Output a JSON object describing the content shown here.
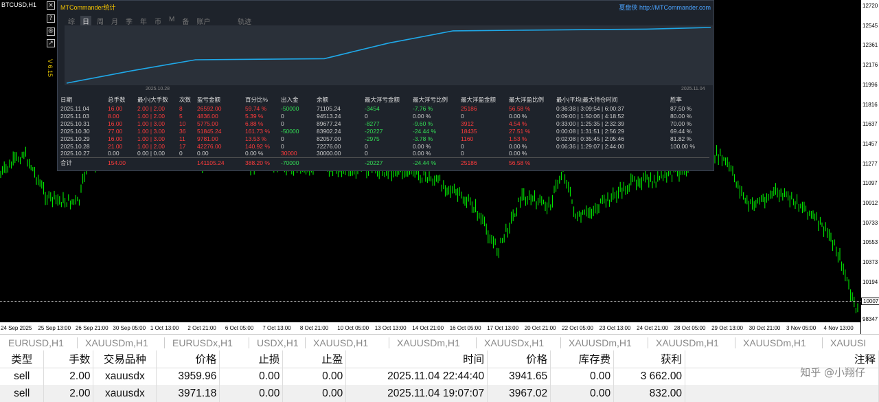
{
  "chart": {
    "symbol_label": "BTCUSD,H1",
    "vertical_label": "V 6.15",
    "side_buttons": [
      "×",
      "?",
      "®"
    ],
    "price_ticks": [
      "12720",
      "12545",
      "12361",
      "12176",
      "11996",
      "11816",
      "11637",
      "11457",
      "11277",
      "11097",
      "10912",
      "10733",
      "10553",
      "10373",
      "10194"
    ],
    "current_price": "10007",
    "bottom_price": "98347",
    "time_ticks": [
      "24 Sep 2025",
      "25 Sep 13:00",
      "26 Sep 21:00",
      "30 Sep 05:00",
      "1 Oct 13:00",
      "2 Oct 21:00",
      "6 Oct 05:00",
      "7 Oct 13:00",
      "8 Oct 21:00",
      "10 Oct 05:00",
      "13 Oct 13:00",
      "14 Oct 21:00",
      "16 Oct 05:00",
      "17 Oct 13:00",
      "20 Oct 21:00",
      "22 Oct 05:00",
      "23 Oct 13:00",
      "24 Oct 21:00",
      "28 Oct 05:00",
      "29 Oct 13:00",
      "30 Oct 21:00",
      "3 Nov 05:00",
      "4 Nov 13:00"
    ],
    "candle_color": "#00ff00"
  },
  "mtc": {
    "title": "MTCommander统计",
    "brand_cn": "夏盘侠",
    "brand_url": "http://MTCommander.com",
    "tabs": [
      "综",
      "日",
      "周",
      "月",
      "季",
      "年",
      "币",
      "M",
      "备",
      "账户"
    ],
    "active_tab": "日",
    "trade_tab": "轨迹",
    "eq_start_date": "2025.10.28",
    "eq_end_date": "2025.11.04",
    "equity_curve": [
      0,
      0.22,
      0.42,
      0.43,
      0.44,
      0.72,
      0.94,
      0.95,
      0.96,
      0.97,
      1.0
    ],
    "equity_line_color": "#1fa8e8",
    "headers": [
      "日期",
      "总手数",
      "最小|大手数",
      "次数",
      "盈亏金额",
      "百分比%",
      "出入金",
      "余额",
      "最大浮亏金额",
      "最大浮亏比例",
      "最大浮盈金额",
      "最大浮盈比例",
      "最小|平均|最大持仓时间",
      "胜率"
    ],
    "rows": [
      [
        "2025.11.04",
        "16.00",
        "2.00 | 2.00",
        "8",
        "26592.00",
        "59.74 %",
        "-50000",
        "71105.24",
        "-3454",
        "-7.76 %",
        "25186",
        "56.58 %",
        "0:36:38 | 3:09:54 | 6:00:37",
        "87.50 %"
      ],
      [
        "2025.11.03",
        "8.00",
        "1.00 | 2.00",
        "5",
        "4836.00",
        "5.39 %",
        "0",
        "94513.24",
        "0",
        "0.00 %",
        "0",
        "0.00 %",
        "0:09:00 | 1:50:06 | 4:18:52",
        "80.00 %"
      ],
      [
        "2025.10.31",
        "16.00",
        "1.00 | 3.00",
        "10",
        "5775.00",
        "6.88 %",
        "0",
        "89677.24",
        "-8277",
        "-9.60 %",
        "3912",
        "4.54 %",
        "0:33:00 | 1:25:35 | 2:32:39",
        "70.00 %"
      ],
      [
        "2025.10.30",
        "77.00",
        "1.00 | 3.00",
        "36",
        "51845.24",
        "161.73 %",
        "-50000",
        "83902.24",
        "-20227",
        "-24.44 %",
        "18435",
        "27.51 %",
        "0:00:08 | 1:31:51 | 2:56:29",
        "69.44 %"
      ],
      [
        "2025.10.29",
        "16.00",
        "1.00 | 3.00",
        "11",
        "9781.00",
        "13.53 %",
        "0",
        "82057.00",
        "-2975",
        "-3.78 %",
        "1160",
        "1.53 %",
        "0:02:08 | 0:35:45 | 2:05:46",
        "81.82 %"
      ],
      [
        "2025.10.28",
        "21.00",
        "1.00 | 2.00",
        "17",
        "42276.00",
        "140.92 %",
        "0",
        "72276.00",
        "0",
        "0.00 %",
        "0",
        "0.00 %",
        "0:06:36 | 1:29:07 | 2:44:00",
        "100.00 %"
      ],
      [
        "2025.10.27",
        "0.00",
        "0.00 | 0.00",
        "0",
        "0.00",
        "0.00 %",
        "30000",
        "30000.00",
        "0",
        "0.00 %",
        "0",
        "0.00 %",
        "",
        ""
      ]
    ],
    "sum_row": [
      "合计",
      "154.00",
      "",
      "",
      "141105.24",
      "388.20 %",
      "-70000",
      "",
      "-20227",
      "-24.44 %",
      "25186",
      "56.58 %",
      "",
      ""
    ]
  },
  "symbol_tabs": [
    "EURUSD,H1",
    "XAUUSDm,H1",
    "EURUSDx,H1",
    "USDX,H1",
    "XAUUSD,H1",
    "XAUUSDm,H1",
    "XAUUSDx,H1",
    "XAUUSDm,H1",
    "XAUUSDm,H1",
    "XAUUSDm,H1",
    "XAUUSI"
  ],
  "orders": {
    "headers": [
      "类型",
      "手数",
      "交易品种",
      "价格",
      "止损",
      "止盈",
      "时间",
      "价格",
      "库存费",
      "获利",
      "注释"
    ],
    "rows": [
      [
        "sell",
        "2.00",
        "xauusdx",
        "3959.96",
        "0.00",
        "0.00",
        "2025.11.04 22:44:40",
        "3941.65",
        "0.00",
        "3 662.00",
        ""
      ],
      [
        "sell",
        "2.00",
        "xauusdx",
        "3971.18",
        "0.00",
        "0.00",
        "2025.11.04 19:07:07",
        "3967.02",
        "0.00",
        "832.00",
        ""
      ]
    ]
  },
  "watermark": "知乎 @小翔仔"
}
